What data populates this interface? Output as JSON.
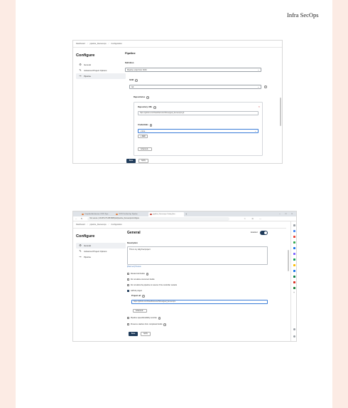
{
  "brand": "Infra SecOps",
  "shot1": {
    "breadcrumb": [
      "Dashboard",
      "pipeline_Devsecops",
      "Configuration"
    ],
    "sidebar_title": "Configure",
    "sidebar_items": [
      {
        "label": "General",
        "icon": "gear-icon"
      },
      {
        "label": "Advanced Project Options",
        "icon": "wrench-icon"
      },
      {
        "label": "Pipeline",
        "icon": "pipeline-icon"
      }
    ],
    "section_title": "Pipeline",
    "definition_label": "Definition",
    "definition_value": "Pipeline script from SCM",
    "scm_label": "SCM",
    "scm_value": "Git",
    "repositories_label": "Repositories",
    "repo_url_label": "Repository URL",
    "repo_url_value": "https://github.com/thaudharsuraz/Streetgeal_devsecops.git",
    "credentials_label": "Credentials",
    "credentials_value": "- none -",
    "add_label": "Add",
    "advanced_label": "Advanced...",
    "save_label": "Save",
    "apply_label": "Apply"
  },
  "shot2": {
    "tabs": [
      "Complete Architecture CI/CD Pipe...",
      "CI/CD DevSecOps Pipeline",
      "pipeline_Devsecops Config [Jen..."
    ],
    "address": "Not secure | 43.205.176.208:8080/job/pipeline_Devsecops/configure",
    "breadcrumb": [
      "Dashboard",
      "pipeline_Devsecops",
      "Configuration"
    ],
    "sidebar_title": "Configure",
    "sidebar_items": [
      {
        "label": "General",
        "icon": "gear-icon"
      },
      {
        "label": "Advanced Project Options",
        "icon": "wrench-icon"
      },
      {
        "label": "Pipeline",
        "icon": "pipeline-icon"
      }
    ],
    "section_title": "General",
    "enabled_label": "Enabled",
    "description_label": "Description",
    "description_value": "This is my ddg final project",
    "plain_text_label": "[Plain text] Preview",
    "options": [
      {
        "label": "Discard old builds",
        "checked": false,
        "help": true
      },
      {
        "label": "Do not allow concurrent builds",
        "checked": false,
        "help": false
      },
      {
        "label": "Do not allow the pipeline to resume if the controller restarts",
        "checked": false,
        "help": false
      },
      {
        "label": "GitHub project",
        "checked": true,
        "help": false
      }
    ],
    "project_url_label": "Project url",
    "project_url_value": "https://github.com/thaudharsuraz/Streetgeal_devsecops",
    "advanced_label": "Advanced...",
    "options_after": [
      {
        "label": "Pipeline speed/durability override",
        "checked": false,
        "help": true
      },
      {
        "label": "Preserve stashes from completed builds",
        "checked": false,
        "help": true
      }
    ],
    "save_label": "Save",
    "apply_label": "Apply",
    "colors": {
      "accent": "#1f3b5a",
      "page_bg": "#fcebe4"
    }
  }
}
